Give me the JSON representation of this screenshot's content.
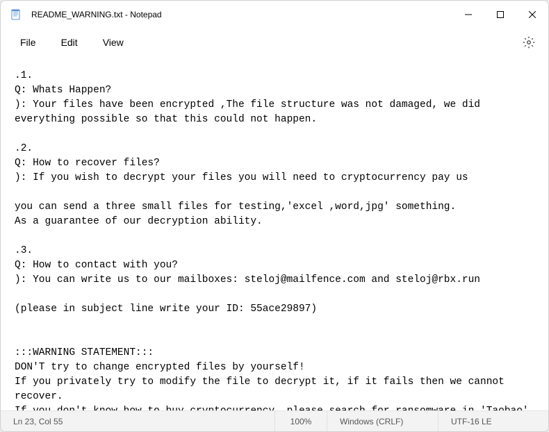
{
  "window": {
    "title": "README_WARNING.txt - Notepad"
  },
  "menu": {
    "file": "File",
    "edit": "Edit",
    "view": "View"
  },
  "content": {
    "text": ".1.\nQ: Whats Happen?\n): Your files have been encrypted ,The file structure was not damaged, we did everything possible so that this could not happen.\n\n.2.\nQ: How to recover files?\n): If you wish to decrypt your files you will need to cryptocurrency pay us\n\nyou can send a three small files for testing,'excel ,word,jpg' something.\nAs a guarantee of our decryption ability.\n\n.3.\nQ: How to contact with you?\n): You can write us to our mailboxes: steloj@mailfence.com and steloj@rbx.run\n\n(please in subject line write your ID: 55ace29897)\n\n\n:::WARNING STATEMENT:::\nDON'T try to change encrypted files by yourself!\nIf you privately try to modify the file to decrypt it, if it fails then we cannot recover.\nIf you don't know how to buy cryptocurrency, please search for ransomware in 'Taobao' there will be many people who are willing to help you."
  },
  "status": {
    "position": "Ln 23, Col 55",
    "zoom": "100%",
    "eol": "Windows (CRLF)",
    "encoding": "UTF-16 LE"
  }
}
